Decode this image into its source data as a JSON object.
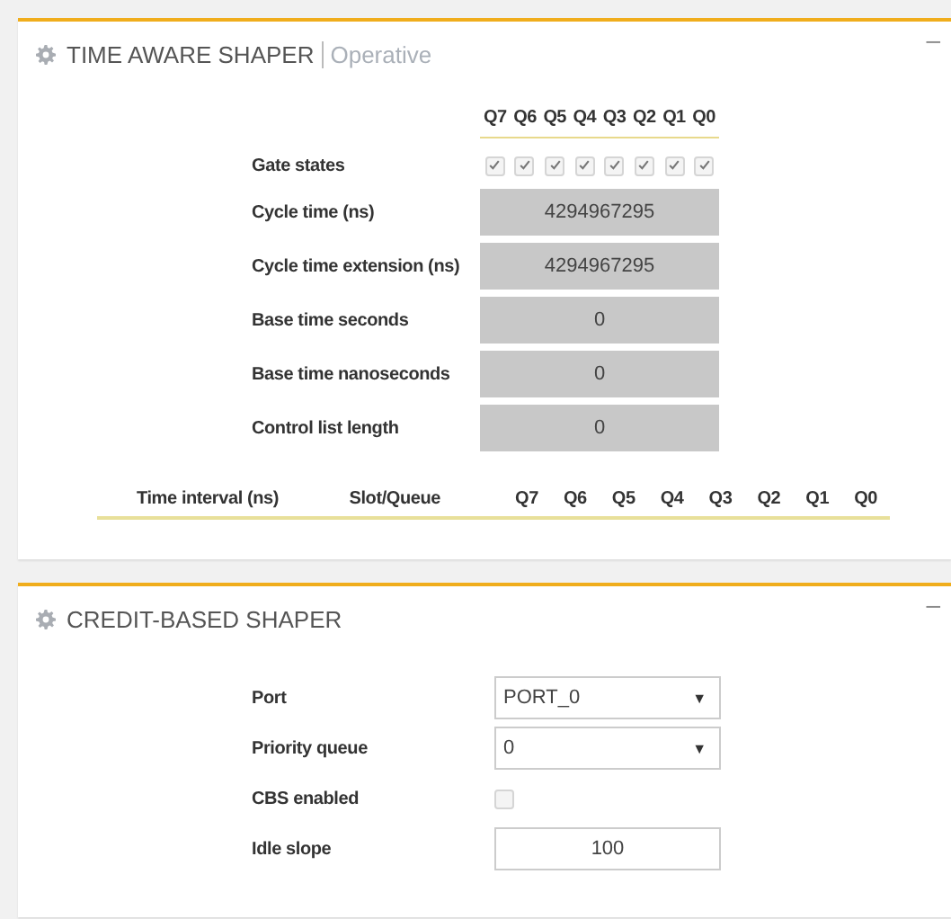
{
  "panels": [
    {
      "kind": "tas",
      "title": "TIME AWARE SHAPER",
      "subtitle": "Operative",
      "collapse": "–",
      "queues": [
        "Q7",
        "Q6",
        "Q5",
        "Q4",
        "Q3",
        "Q2",
        "Q1",
        "Q0"
      ],
      "rows": [
        {
          "kind": "gates",
          "label": "Gate states",
          "gates": [
            {
              "checked": true
            },
            {
              "checked": true
            },
            {
              "checked": true
            },
            {
              "checked": true
            },
            {
              "checked": true
            },
            {
              "checked": true
            },
            {
              "checked": true
            },
            {
              "checked": true
            }
          ]
        },
        {
          "kind": "readonly",
          "label": "Cycle time (ns)",
          "value": "4294967295"
        },
        {
          "kind": "readonly",
          "label": "Cycle time extension (ns)",
          "value": "4294967295"
        },
        {
          "kind": "readonly",
          "label": "Base time seconds",
          "value": "0"
        },
        {
          "kind": "readonly",
          "label": "Base time nanoseconds",
          "value": "0"
        },
        {
          "kind": "readonly",
          "label": "Control list length",
          "value": "0"
        }
      ],
      "table": {
        "columns": [
          "Time interval (ns)",
          "Slot/Queue",
          "Q7",
          "Q6",
          "Q5",
          "Q4",
          "Q3",
          "Q2",
          "Q1",
          "Q0"
        ]
      }
    },
    {
      "kind": "cbs",
      "title": "CREDIT-BASED SHAPER",
      "collapse": "–",
      "rows": [
        {
          "kind": "select",
          "label": "Port",
          "value": "PORT_0",
          "arrow": "▼"
        },
        {
          "kind": "select",
          "label": "Priority queue",
          "value": "0",
          "arrow": "▼"
        },
        {
          "kind": "checkbox",
          "label": "CBS enabled",
          "checked": false
        },
        {
          "kind": "input",
          "label": "Idle slope",
          "value": "100"
        }
      ]
    }
  ]
}
